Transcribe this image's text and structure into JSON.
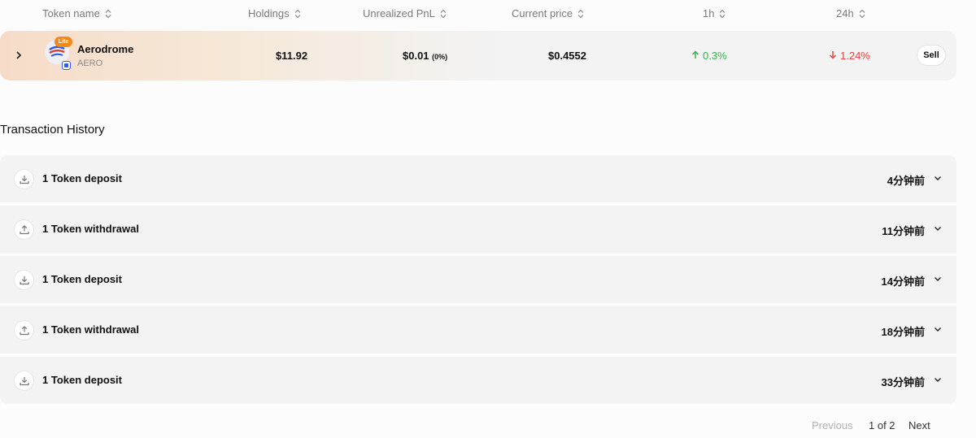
{
  "table": {
    "headers": {
      "token_name": "Token name",
      "holdings": "Holdings",
      "unrealized_pnl": "Unrealized PnL",
      "current_price": "Current price",
      "h1": "1h",
      "h24": "24h"
    },
    "rows": [
      {
        "name": "Aerodrome",
        "symbol": "AERO",
        "badge": "Lite",
        "holdings": "$11.92",
        "pnl_value": "$0.01",
        "pnl_percent": "(0%)",
        "current_price": "$0.4552",
        "change_1h": "0.3%",
        "change_24h": "1.24%",
        "sell_label": "Sell"
      }
    ]
  },
  "history": {
    "title": "Transaction History",
    "items": [
      {
        "icon": "download-icon",
        "label": "1 Token deposit",
        "time": "4分钟前"
      },
      {
        "icon": "upload-icon",
        "label": "1 Token withdrawal",
        "time": "11分钟前"
      },
      {
        "icon": "download-icon",
        "label": "1 Token deposit",
        "time": "14分钟前"
      },
      {
        "icon": "upload-icon",
        "label": "1 Token withdrawal",
        "time": "18分钟前"
      },
      {
        "icon": "download-icon",
        "label": "1 Token deposit",
        "time": "33分钟前"
      }
    ]
  },
  "pagination": {
    "previous": "Previous",
    "page_info": "1 of 2",
    "next": "Next"
  },
  "colors": {
    "positive": "#35b34a",
    "negative": "#e5443f",
    "badge": "#f28a17",
    "chain": "#2c5cf5"
  }
}
